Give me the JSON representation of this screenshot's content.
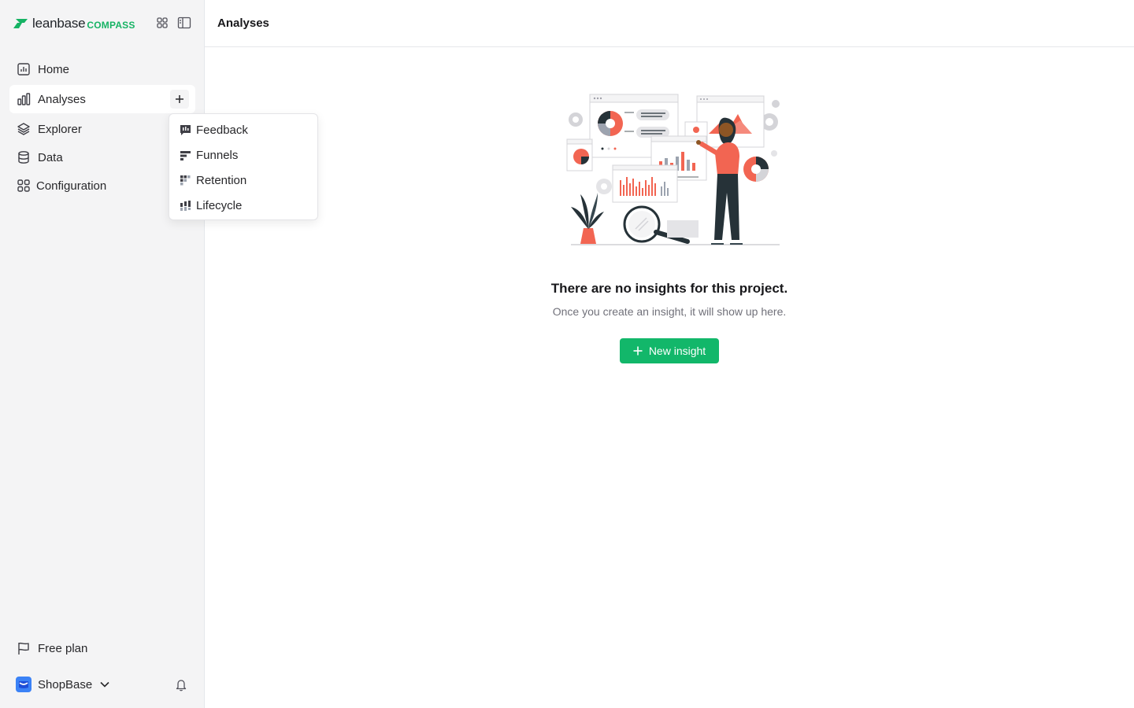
{
  "brand": {
    "name": "leanbase",
    "product": "COMPASS",
    "accent": "#16b364"
  },
  "header": {
    "title": "Analyses"
  },
  "sidebar": {
    "items": [
      {
        "label": "Home",
        "icon": "chart-square-icon"
      },
      {
        "label": "Analyses",
        "icon": "bar-chart-icon",
        "active": true
      },
      {
        "label": "Explorer",
        "icon": "layers-icon"
      },
      {
        "label": "Data",
        "icon": "database-icon"
      },
      {
        "label": "Configuration",
        "icon": "grid-icon"
      }
    ],
    "footer": {
      "plan_label": "Free plan",
      "project_label": "ShopBase"
    }
  },
  "dropdown": {
    "items": [
      {
        "label": "Feedback",
        "icon": "feedback-icon"
      },
      {
        "label": "Funnels",
        "icon": "funnels-icon"
      },
      {
        "label": "Retention",
        "icon": "retention-icon"
      },
      {
        "label": "Lifecycle",
        "icon": "lifecycle-icon"
      }
    ]
  },
  "empty_state": {
    "title": "There are no insights for this project.",
    "subtitle": "Once you create an insight, it will show up here.",
    "button_label": "New insight"
  },
  "colors": {
    "primary_button": "#12b76a",
    "illustration_accent": "#f26552",
    "illustration_dark": "#263238"
  }
}
